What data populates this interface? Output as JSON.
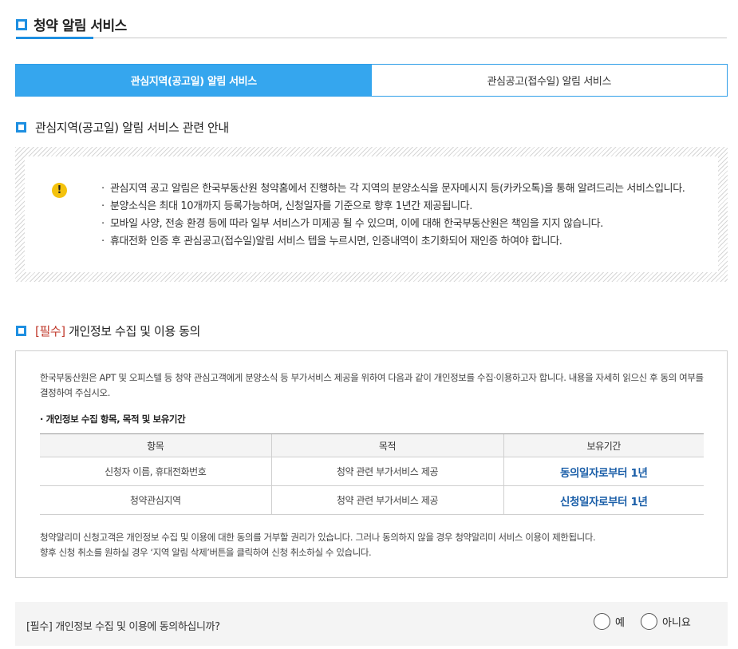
{
  "page": {
    "title": "청약 알림 서비스"
  },
  "tabs": [
    {
      "label": "관심지역(공고일) 알림 서비스",
      "active": true
    },
    {
      "label": "관심공고(접수일) 알림 서비스",
      "active": false
    }
  ],
  "notice_section": {
    "heading": "관심지역(공고일) 알림 서비스 관련 안내",
    "icon": "warning-icon",
    "items": [
      "관심지역 공고 알림은 한국부동산원 청약홈에서 진행하는 각 지역의 분양소식을 문자메시지 등(카카오톡)을 통해 알려드리는 서비스입니다.",
      "분양소식은 최대 10개까지 등록가능하며, 신청일자를 기준으로 향후 1년간 제공됩니다.",
      "모바일 사양, 전송 환경 등에 따라 일부 서비스가 미제공 될 수 있으며, 이에 대해 한국부동산원은 책임을 지지 않습니다.",
      "휴대전화 인증 후 관심공고(접수일)알림 서비스 텝을 누르시면, 인증내역이 초기화되어 재인증 하여야 합니다."
    ]
  },
  "consent_section": {
    "required_tag": "[필수]",
    "heading": " 개인정보 수집 및 이용 동의",
    "intro": "한국부동산원은 APT 및 오피스텔 등 청약 관심고객에게 분양소식 등 부가서비스 제공을 위하여 다음과 같이 개인정보를 수집·이용하고자 합니다. 내용을 자세히 읽으신 후 동의 여부를 결정하여 주십시오.",
    "subheading": "· 개인정보 수집 항목, 목적 및 보유기간",
    "table": {
      "headers": [
        "항목",
        "목적",
        "보유기간"
      ],
      "rows": [
        [
          "신청자 이름, 휴대전화번호",
          "청약 관련 부가서비스 제공",
          "동의일자로부터 1년"
        ],
        [
          "청약관심지역",
          "청약 관련 부가서비스 제공",
          "신청일자로부터 1년"
        ]
      ]
    },
    "outro_1": "청약알리미 신청고객은 개인정보 수집 및 이용에 대한 동의를 거부할 권리가 있습니다. 그러나 동의하지 않을 경우 청약알리미 서비스 이용이 제한됩니다.",
    "outro_2": "향후 신청 취소를 원하실 경우 ‘지역 알림 삭제’버튼을 클릭하여 신청 취소하실 수 있습니다."
  },
  "agree_bar": {
    "question": "[필수] 개인정보 수집 및 이용에 동의하십니까?",
    "yes_label": "예",
    "no_label": "아니요"
  },
  "colors": {
    "accent": "#1e8fe1",
    "tab_active": "#35a6ee",
    "required": "#c0392b",
    "period": "#1a5ea8",
    "warning": "#f4c20d"
  }
}
